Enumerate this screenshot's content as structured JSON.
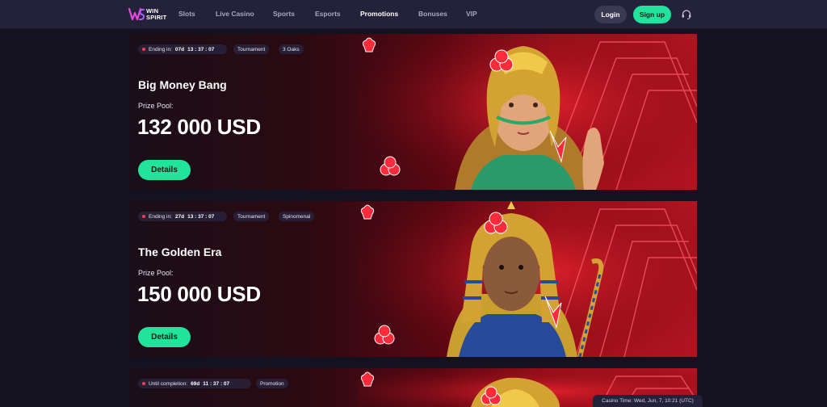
{
  "header": {
    "logo_line1": "WIN",
    "logo_line2": "SPIRIT",
    "nav": [
      {
        "label": "Slots"
      },
      {
        "label": "Live Casino"
      },
      {
        "label": "Sports"
      },
      {
        "label": "Esports"
      },
      {
        "label": "Promotions"
      },
      {
        "label": "Bonuses"
      },
      {
        "label": "VIP"
      }
    ],
    "active_nav": "Promotions",
    "login_label": "Login",
    "signup_label": "Sign up",
    "support_icon": "headset-icon"
  },
  "promotions": [
    {
      "status_label": "Ending in:",
      "timer_days": "07d",
      "timer_time": "13 : 37 : 07",
      "tags": [
        "Tournament",
        "3 Oaks"
      ],
      "title": "Big Money Bang",
      "prize_label": "Prize Pool:",
      "prize_value": "132 000 USD",
      "button_label": "Details",
      "art": "egyptian-queen-illustration"
    },
    {
      "status_label": "Ending in:",
      "timer_days": "27d",
      "timer_time": "13 : 37 : 07",
      "tags": [
        "Tournament",
        "Spinomenal"
      ],
      "title": "The Golden Era",
      "prize_label": "Prize Pool:",
      "prize_value": "150 000 USD",
      "button_label": "Details",
      "art": "pharaoh-illustration"
    },
    {
      "status_label": "Until completion:",
      "timer_days": "69d",
      "timer_time": "11 : 37 : 07",
      "tags": [
        "Promotion"
      ],
      "art": "golden-lion-illustration"
    }
  ],
  "casino_time": "Casino Time: Wed, Jun, 7, 10:21 (UTC)",
  "colors": {
    "header_bg": "#24213a",
    "page_bg": "#141220",
    "accent_green": "#22e39b",
    "banner_red": "#a0101a",
    "timer_dot": "#ff3a5c"
  }
}
